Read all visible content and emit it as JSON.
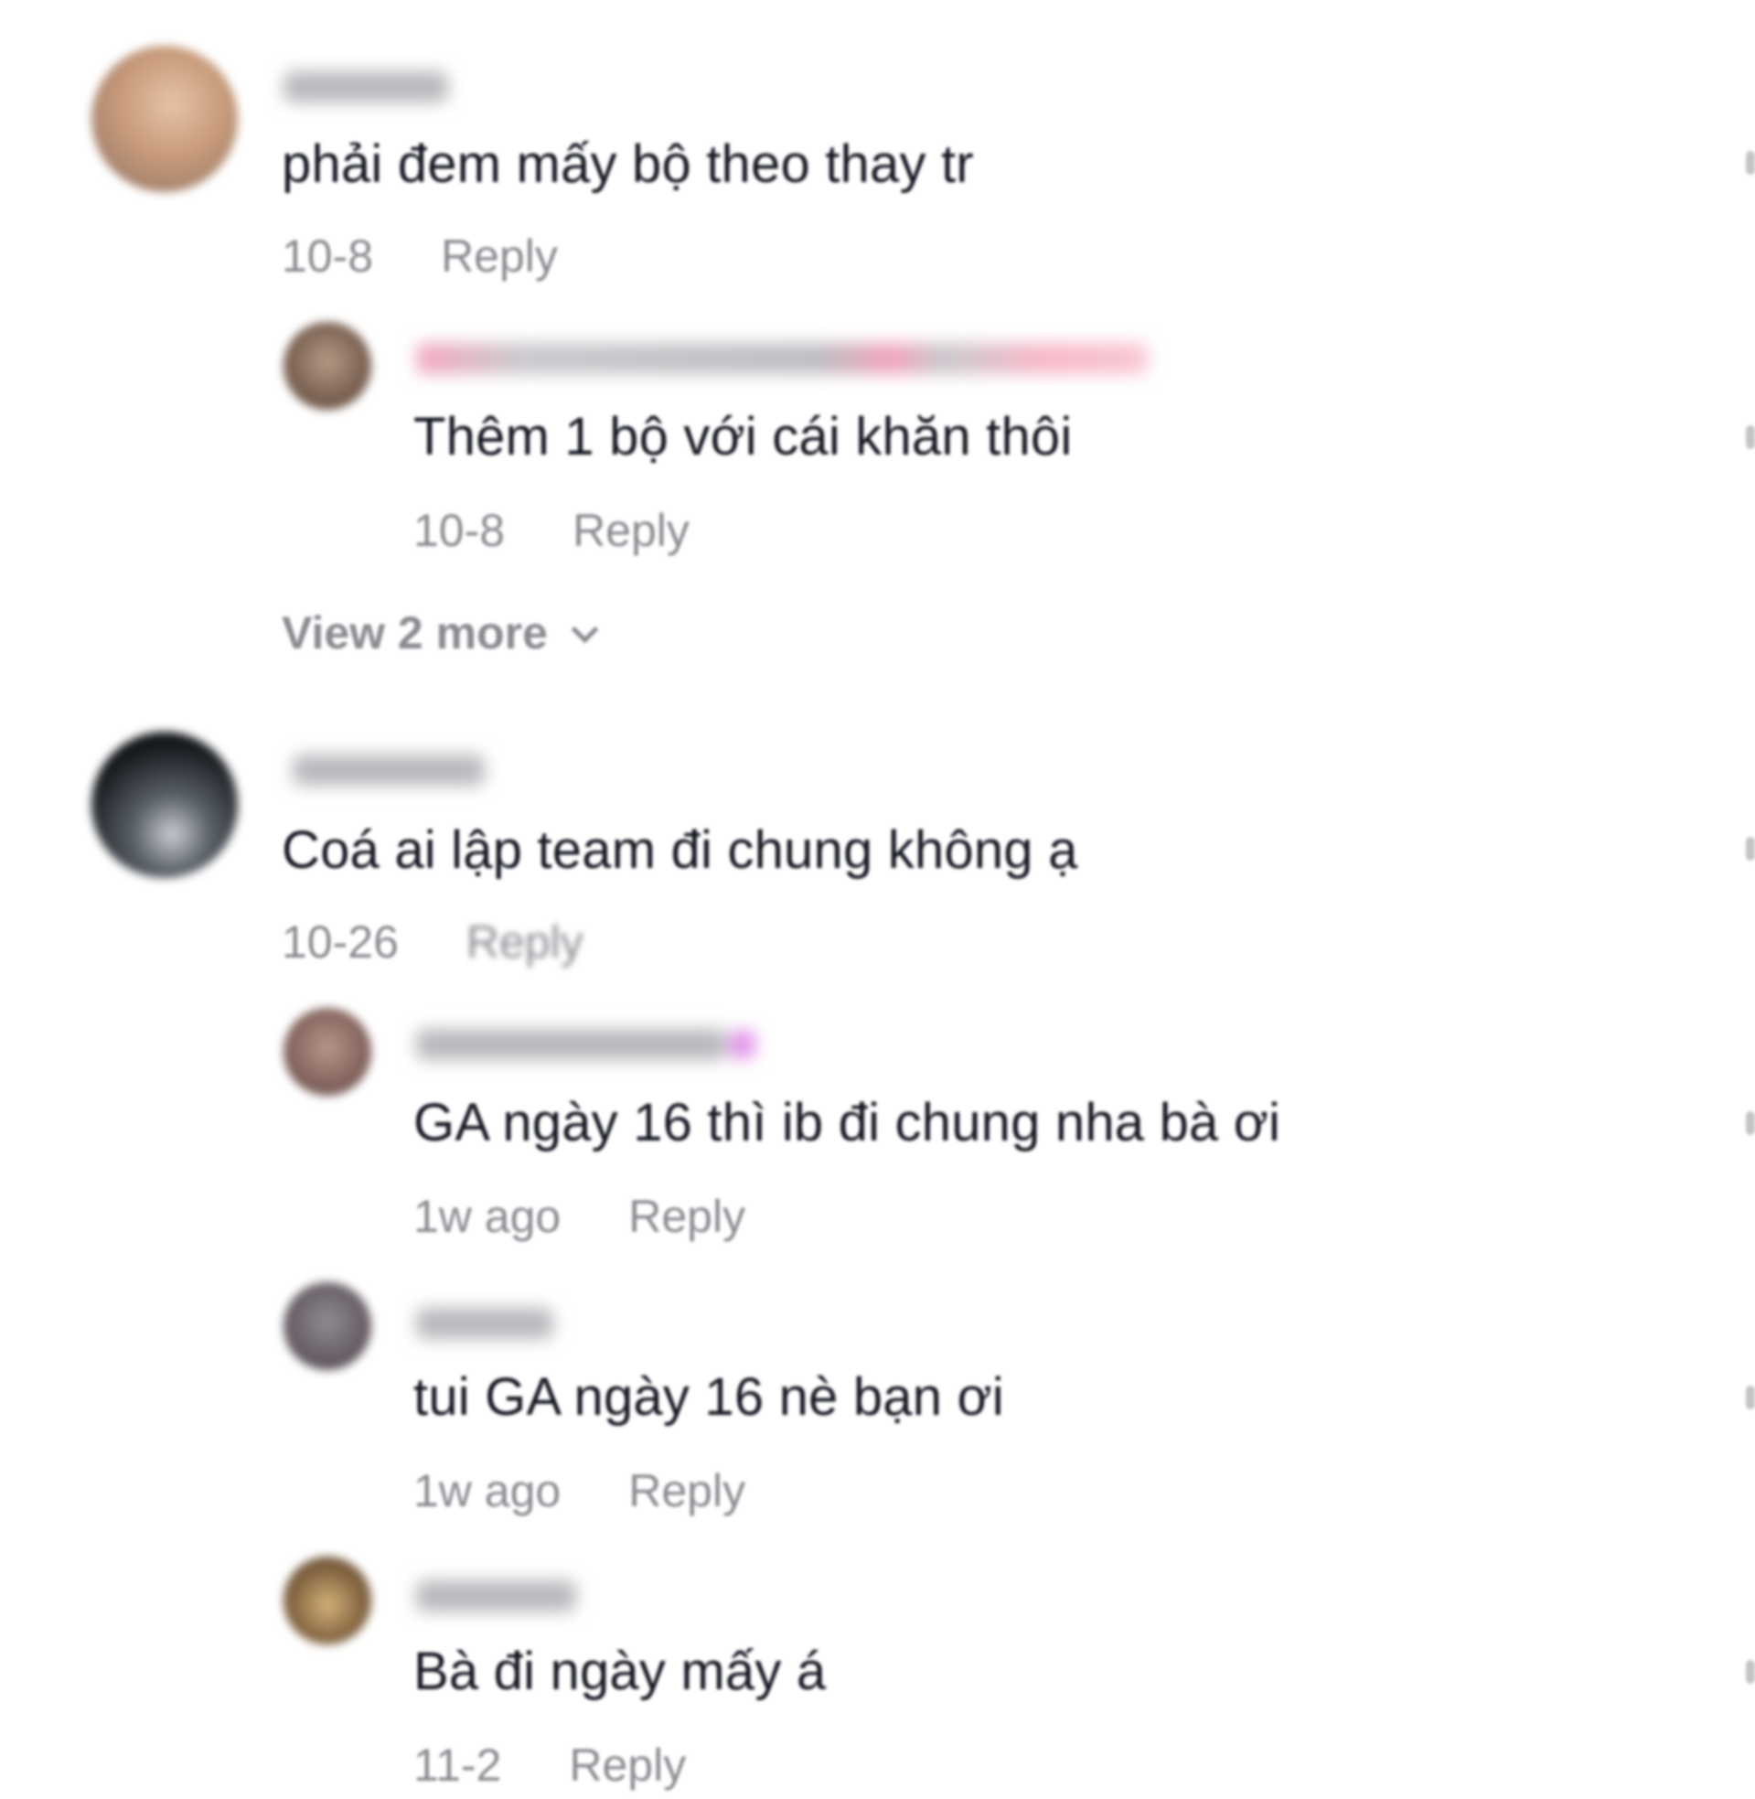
{
  "comments": [
    {
      "text": "phải đem mấy bộ theo thay tr",
      "date": "10-8",
      "reply_label": "Reply",
      "replies": [
        {
          "text": "Thêm 1 bộ với cái khăn thôi",
          "date": "10-8",
          "reply_label": "Reply"
        }
      ],
      "view_more_label": "View 2 more"
    },
    {
      "text": "Coá ai lập team đi chung không ạ",
      "date": "10-26",
      "reply_label": "Reply",
      "replies": [
        {
          "text": "GA ngày 16 thì ib đi chung nha bà ơi",
          "date": "1w ago",
          "reply_label": "Reply"
        },
        {
          "text": "tui GA ngày 16 nè bạn ơi",
          "date": "1w ago",
          "reply_label": "Reply"
        },
        {
          "text": "Bà đi ngày mấy á",
          "date": "11-2",
          "reply_label": "Reply"
        }
      ]
    }
  ],
  "icons": {
    "more_options": "ellipsis-vertical-icon",
    "expand": "chevron-down-icon"
  },
  "colors": {
    "text_primary": "#161823",
    "text_secondary": "#8a8b91",
    "background": "#ffffff"
  }
}
